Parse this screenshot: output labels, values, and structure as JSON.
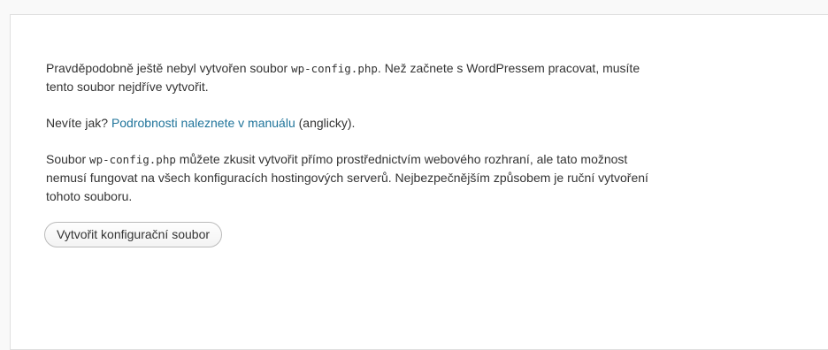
{
  "setup": {
    "para1": {
      "before": "Pravděpodobně ještě nebyl vytvořen soubor ",
      "code": "wp-config.php",
      "after_line1": ". Než začnete s WordPressem pracovat, musíte",
      "line2": "tento soubor nejdříve vytvořit."
    },
    "para2": {
      "before": "Nevíte jak? ",
      "link": "Podrobnosti naleznete v manuálu",
      "after": " (anglicky)."
    },
    "para3": {
      "before": "Soubor ",
      "code": "wp-config.php",
      "after_line1": " můžete zkusit vytvořit přímo prostřednictvím webového rozhraní, ale tato možnost",
      "line2": "nemusí fungovat na všech konfiguracích hostingových serverů. Nejbezpečnějším způsobem je ruční vytvoření",
      "line3": "tohoto souboru."
    },
    "button_label": "Vytvořit konfigurační soubor",
    "link_color": "#21759b"
  }
}
